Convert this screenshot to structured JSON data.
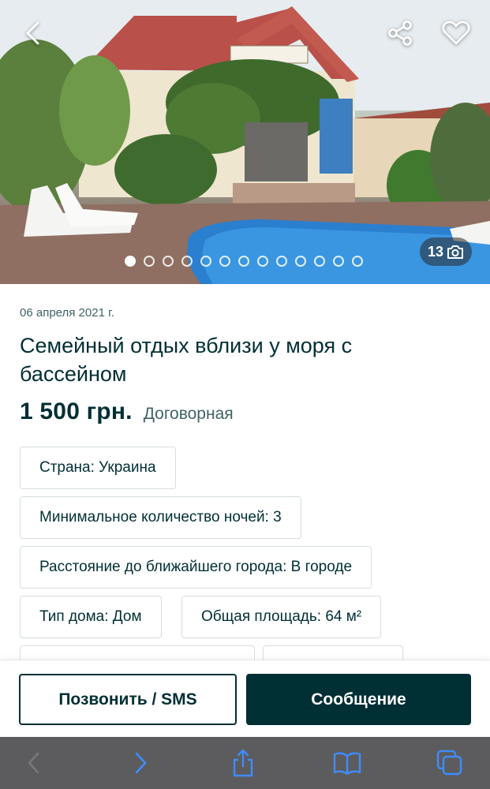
{
  "gallery": {
    "photo_count": "13",
    "dots_total": 13,
    "active_dot": 0
  },
  "listing": {
    "date": "06 апреля 2021 г.",
    "title": "Семейный отдых вблизи у моря с бассейном",
    "price": "1 500 грн.",
    "price_note": "Договорная",
    "tags": [
      "Страна: Украина",
      "Минимальное количество ночей: 3",
      "Расстояние до ближайшего города: В городе",
      "Тип дома: Дом",
      "Общая площадь: 64 м²"
    ]
  },
  "actions": {
    "call_label": "Позвонить / SMS",
    "message_label": "Сообщение"
  },
  "colors": {
    "brand_dark": "#002f34",
    "muted_text": "#406367",
    "browser_bar": "#5c5c5e",
    "browser_active_icon": "#3f8cff"
  },
  "icons": {
    "back": "chevron-left-icon",
    "share": "share-icon",
    "favorite": "heart-icon",
    "camera": "camera-icon"
  }
}
